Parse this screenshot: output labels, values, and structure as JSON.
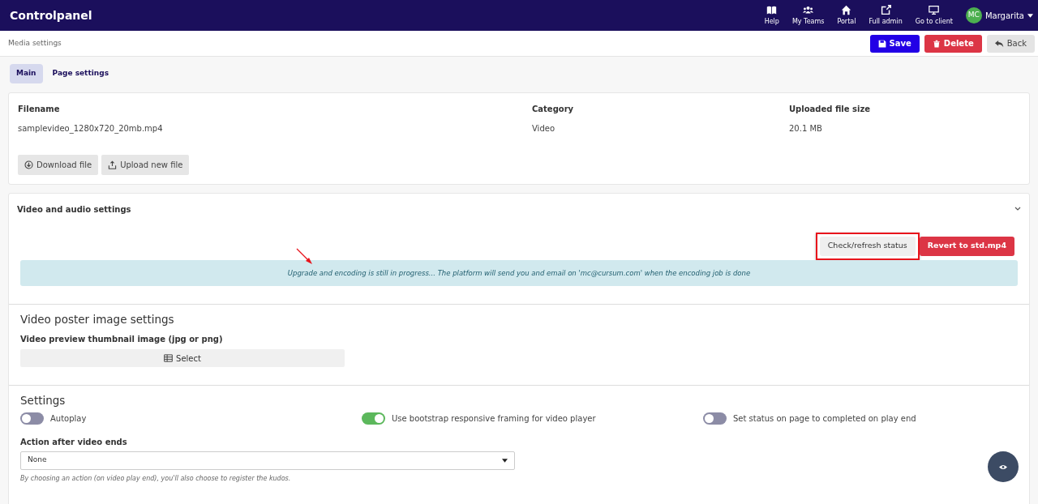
{
  "navbar": {
    "brand": "Controlpanel",
    "items": [
      {
        "label": "Help",
        "kind": "help"
      },
      {
        "label": "My Teams",
        "kind": "teams"
      },
      {
        "label": "Portal",
        "kind": "portal"
      },
      {
        "label": "Full admin",
        "kind": "admin"
      },
      {
        "label": "Go to client",
        "kind": "client"
      }
    ],
    "user": {
      "initials": "MC",
      "name": "Margarita"
    }
  },
  "header": {
    "title": "Media settings",
    "buttons": [
      {
        "label": "Save",
        "kind": "save"
      },
      {
        "label": "Delete",
        "kind": "delete"
      },
      {
        "label": "Back",
        "kind": "back"
      }
    ]
  },
  "tabs": [
    {
      "label": "Main",
      "selected": true
    },
    {
      "label": "Page settings",
      "selected": false
    }
  ],
  "file": {
    "columns": [
      {
        "label": "Filename",
        "value": "samplevideo_1280x720_20mb.mp4"
      },
      {
        "label": "Category",
        "value": "Video"
      },
      {
        "label": "Uploaded file size",
        "value": "20.1 MB"
      }
    ],
    "buttons": [
      {
        "label": "Download file",
        "kind": "download"
      },
      {
        "label": "Upload new file",
        "kind": "upload"
      }
    ]
  },
  "video_audio": {
    "title": "Video and audio settings",
    "expanded": true,
    "buttons": [
      {
        "label": "Check/refresh status",
        "kind": "light",
        "highlighted": true
      },
      {
        "label": "Revert to std.mp4",
        "kind": "danger",
        "highlighted": false
      }
    ],
    "annotation_arrow": true,
    "alert": "Upgrade and encoding is still in progress... The platform will send you and email on 'mc@cursum.com' when the encoding job is done"
  },
  "poster": {
    "title": "Video poster image settings",
    "label": "Video preview thumbnail image (jpg or png)",
    "button": "Select"
  },
  "settings": {
    "title": "Settings",
    "toggles": [
      {
        "label": "Autoplay",
        "checked": false
      },
      {
        "label": "Use bootstrap responsive framing for video player",
        "checked": true
      },
      {
        "label": "Set status on page to completed on play end",
        "checked": false
      }
    ],
    "action_label": "Action after video ends",
    "action_value": "None",
    "help": "By choosing an action (on video play end), you'll also choose to register the kudos."
  }
}
